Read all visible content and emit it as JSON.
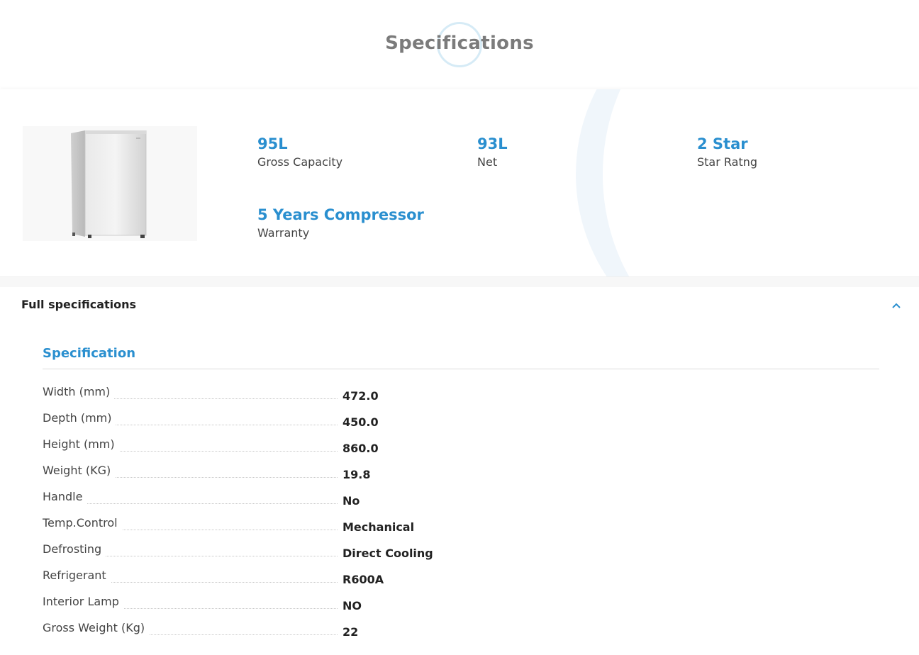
{
  "header": {
    "title": "Specifications"
  },
  "summary": {
    "stats": [
      {
        "value": "95L",
        "label": "Gross Capacity"
      },
      {
        "value": "93L",
        "label": "Net"
      },
      {
        "value": "2 Star",
        "label": "Star Ratng"
      },
      {
        "value": "5 Years Compressor",
        "label": "Warranty"
      }
    ]
  },
  "full_specs": {
    "title": "Full specifications"
  },
  "specification": {
    "title": "Specification",
    "rows": [
      {
        "label": "Width (mm)",
        "value": "472.0"
      },
      {
        "label": "Depth (mm)",
        "value": "450.0"
      },
      {
        "label": "Height (mm)",
        "value": "860.0"
      },
      {
        "label": "Weight (KG)",
        "value": "19.8"
      },
      {
        "label": "Handle",
        "value": "No"
      },
      {
        "label": "Temp.Control",
        "value": "Mechanical"
      },
      {
        "label": "Defrosting",
        "value": "Direct Cooling"
      },
      {
        "label": "Refrigerant",
        "value": "R600A"
      },
      {
        "label": "Interior Lamp",
        "value": "NO"
      },
      {
        "label": "Gross Weight (Kg)",
        "value": "22"
      }
    ]
  },
  "colors": {
    "accent": "#2a8fcf",
    "title_gray": "#7b7b7b"
  },
  "icons": {
    "collapse": "chevron-up-icon"
  }
}
